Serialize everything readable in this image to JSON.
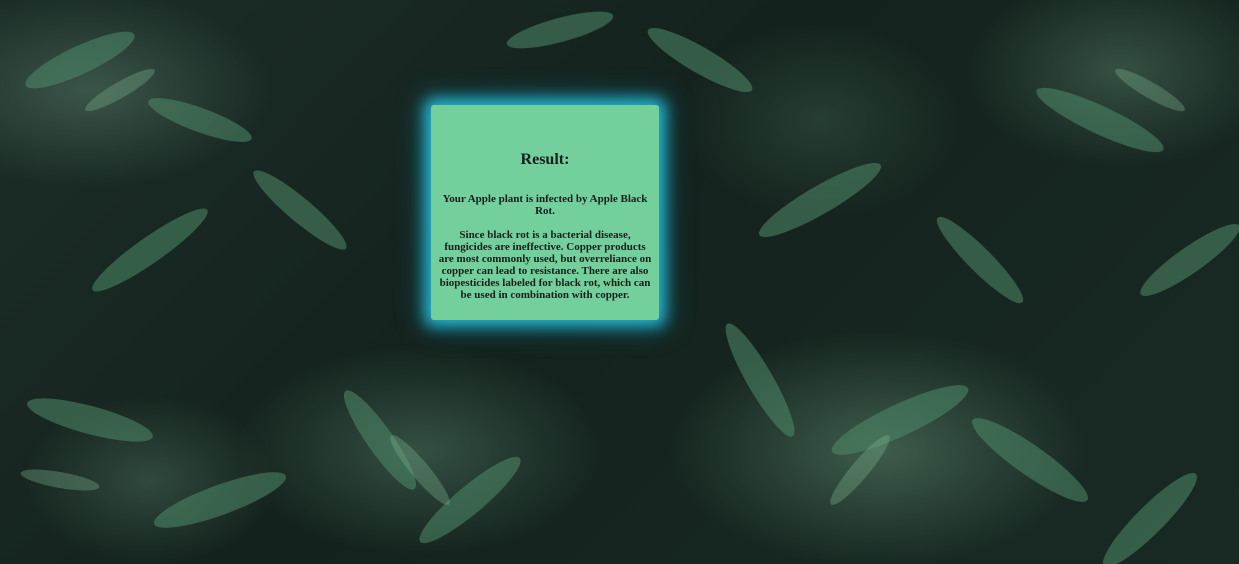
{
  "result": {
    "title": "Result:",
    "diagnosis": "Your Apple plant is infected by Apple Black Rot.",
    "treatment": "Since black rot is a bacterial disease, fungicides are ineffective. Copper products are most commonly used, but overreliance on copper can lead to resistance. There are also biopesticides labeled for black rot, which can be used in combination with copper."
  },
  "colors": {
    "card_background": "#73cf9c",
    "card_glow": "#28c8e6",
    "page_background": "#16241f"
  }
}
